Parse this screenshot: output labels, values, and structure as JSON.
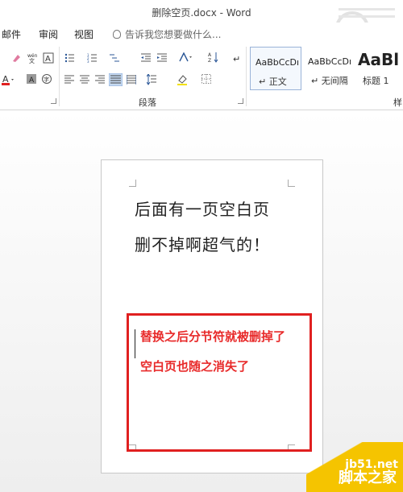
{
  "window": {
    "title": "删除空页.docx - Word"
  },
  "menu": {
    "items": [
      "邮件",
      "审阅",
      "视图"
    ],
    "tell_me": "告诉我您想要做什么..."
  },
  "ribbon": {
    "paragraph_group_label": "段落",
    "styles_group_label": "样",
    "styles": [
      {
        "sample": "AaBbCcDı",
        "name": "↵ 正文",
        "selected": true
      },
      {
        "sample": "AaBbCcDı",
        "name": "↵ 无间隔",
        "selected": false
      },
      {
        "sample": "AaBl",
        "name": "标题 1",
        "selected": false
      }
    ]
  },
  "document": {
    "lines": [
      "后面有一页空白页",
      "删不掉啊超气的！"
    ]
  },
  "annotation": {
    "lines": [
      "替换之后分节符就被删掉了",
      "空白页也随之消失了"
    ],
    "color": "#e02020"
  },
  "watermark": {
    "site": "jb51.net",
    "brand": "脚本之家"
  }
}
